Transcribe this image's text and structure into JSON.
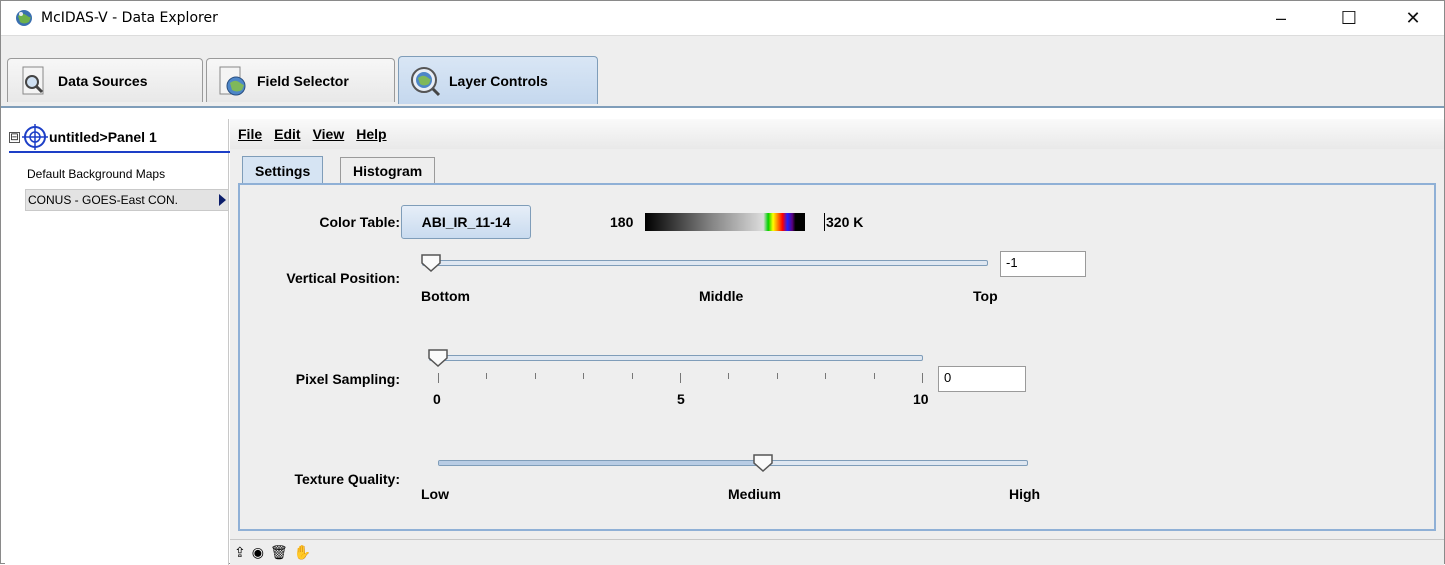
{
  "window": {
    "title": "McIDAS-V - Data Explorer",
    "minimize_glyph": "–",
    "maximize_glyph": "☐",
    "close_glyph": "✕",
    "app_icon": "mcidas-globe-icon"
  },
  "tabs": [
    {
      "label": "Data Sources",
      "icon": "magnifier-document-icon"
    },
    {
      "label": "Field Selector",
      "icon": "globe-document-icon"
    },
    {
      "label": "Layer Controls",
      "icon": "globe-magnifier-icon",
      "active": true
    }
  ],
  "left_panel": {
    "tree_root": "untitled>Panel 1",
    "toggle_glyph": "⊟",
    "items": [
      {
        "label": "Default Background Maps"
      },
      {
        "label": "CONUS - GOES-East CON.",
        "selected": true
      }
    ]
  },
  "menu": {
    "items": [
      "File",
      "Edit",
      "View",
      "Help"
    ]
  },
  "subtabs": [
    {
      "label": "Settings",
      "active": true
    },
    {
      "label": "Histogram"
    }
  ],
  "settings": {
    "color_table": {
      "label": "Color Table:",
      "button": "ABI_IR_11-14",
      "min": "180",
      "max": "320 K"
    },
    "vertical_position": {
      "label": "Vertical Position:",
      "value": "-1",
      "fraction": 0.0,
      "ticks": [
        "Bottom",
        "Middle",
        "Top"
      ]
    },
    "pixel_sampling": {
      "label": "Pixel Sampling:",
      "value": "0",
      "min": 0,
      "max": 10,
      "current": 0,
      "ticks": [
        "0",
        "5",
        "10"
      ]
    },
    "texture_quality": {
      "label": "Texture Quality:",
      "fraction": 0.55,
      "ticks": [
        "Low",
        "Medium",
        "High"
      ]
    }
  },
  "statusbar": {
    "icons": [
      "eject-icon",
      "globe-icon",
      "trash-icon",
      "hand-icon"
    ],
    "glyphs": [
      "⇪",
      "◉",
      "🗑",
      "✋"
    ]
  },
  "colors": {
    "accent": "#7f9db9",
    "tree_underline": "#1d3fc7",
    "selected_bg": "#e3e3e3"
  }
}
